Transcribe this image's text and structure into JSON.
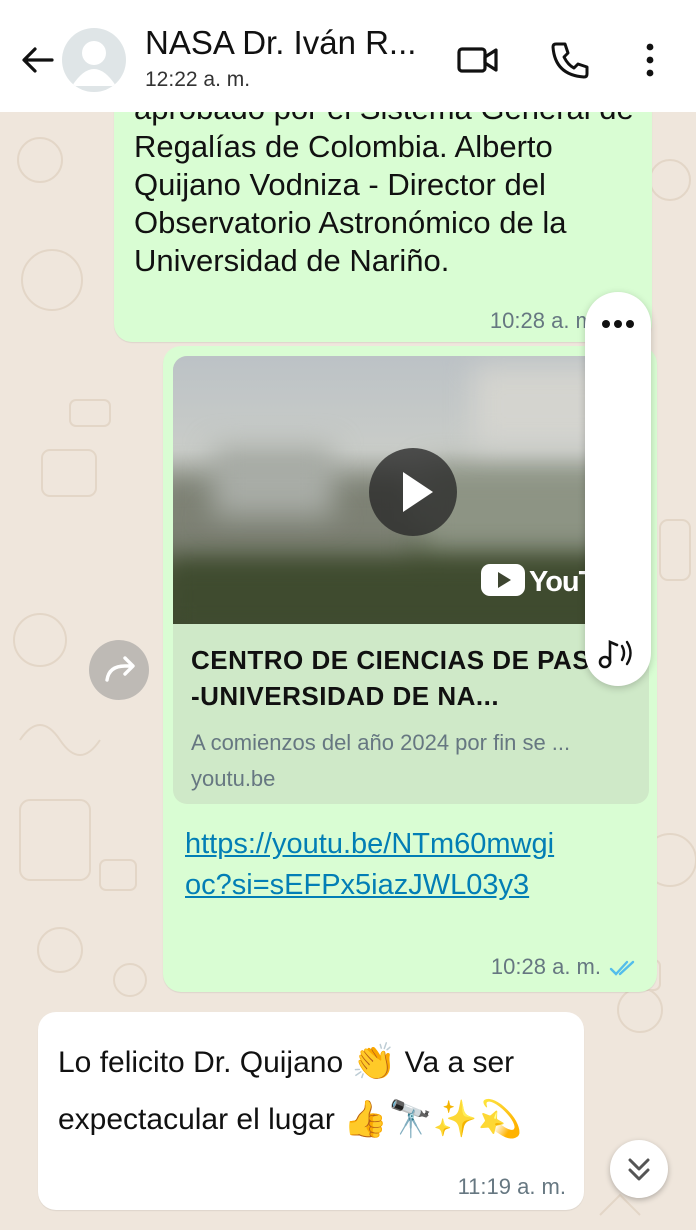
{
  "header": {
    "contact_name": "NASA Dr. Iván R...",
    "status": "12:22 a. m."
  },
  "messages": [
    {
      "direction": "outgoing",
      "text": "aprobado por el Sistema General de Regalías de Colombia. Alberto Quijano Vodniza - Director del Observatorio Astronómico de la Universidad de Nariño.",
      "time": "10:28 a. m."
    },
    {
      "direction": "outgoing",
      "preview": {
        "thumbnail_brand": "YouTu",
        "title": "CENTRO DE CIENCIAS DE PASTO -UNIVERSIDAD DE NA...",
        "description": "A comienzos del año 2024 por fin se ...",
        "domain": "youtu.be"
      },
      "link": "https://youtu.be/NTm60mwgioc?si=sEFPx5iazJWL03y3",
      "time": "10:28 a. m.",
      "receipt": "read-double-check"
    },
    {
      "direction": "incoming",
      "text_1": "Lo felicito Dr. Quijano",
      "emoji_1": "👏",
      "text_2": "Va a ser expectacular el lugar",
      "emoji_2": "👍🔭✨💫",
      "time": "11:19 a. m."
    }
  ],
  "icons": {
    "back": "arrow-left-icon",
    "video": "video-camera-icon",
    "call": "phone-icon",
    "menu": "more-vertical-icon",
    "play": "play-icon",
    "forward": "forward-icon",
    "more": "more-horizontal-icon",
    "audio": "music-note-icon",
    "scroll_down": "chevron-double-down-icon"
  },
  "colors": {
    "outgoing_bubble": "#d9fdd3",
    "incoming_bubble": "#ffffff",
    "link": "#027eb5",
    "read_ticks": "#53bdeb",
    "chat_background": "#efe6dc"
  }
}
